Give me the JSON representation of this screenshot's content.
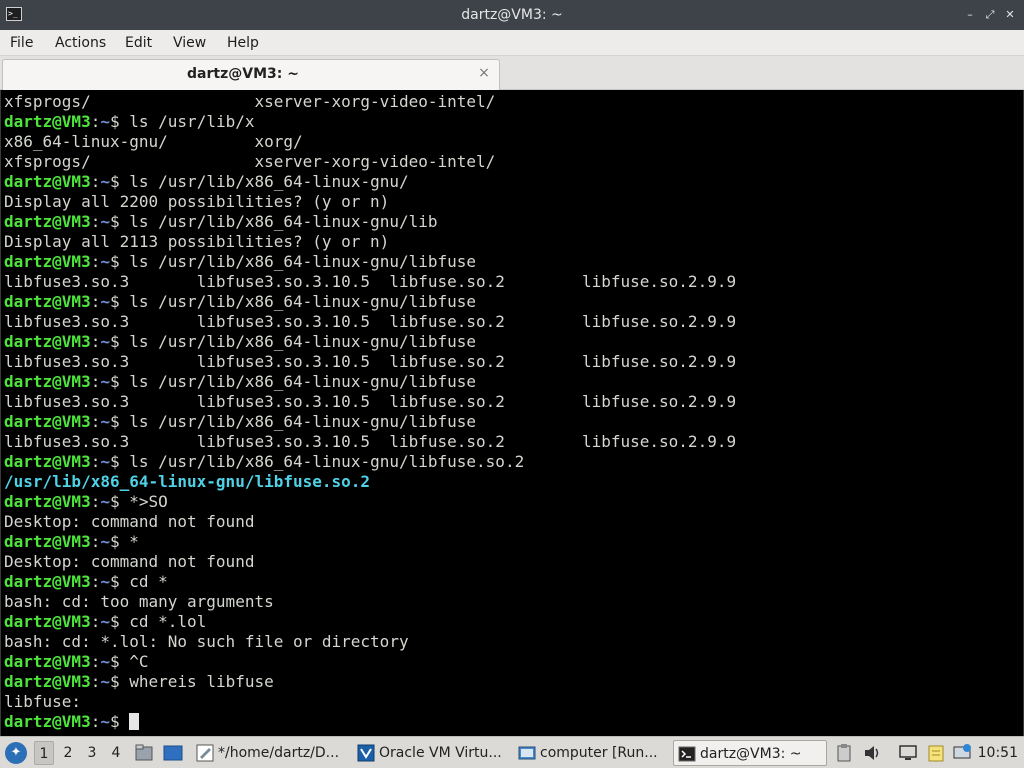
{
  "window": {
    "title": "dartz@VM3: ~",
    "minimize_glyph": "–",
    "maximize_glyph": "⤢",
    "close_glyph": "✕"
  },
  "menu": [
    "File",
    "Actions",
    "Edit",
    "View",
    "Help"
  ],
  "tab": {
    "label": "dartz@VM3: ~",
    "close_glyph": "×"
  },
  "prompt": {
    "user": "dartz@VM3",
    "sep": ":",
    "path": "~",
    "symbol": "$"
  },
  "terminal": {
    "lines": [
      {
        "type": "out",
        "text": "xfsprogs/                 xserver-xorg-video-intel/"
      },
      {
        "type": "cmd",
        "text": " ls /usr/lib/x"
      },
      {
        "type": "out",
        "text": "x86_64-linux-gnu/         xorg/"
      },
      {
        "type": "out",
        "text": "xfsprogs/                 xserver-xorg-video-intel/"
      },
      {
        "type": "cmd",
        "text": " ls /usr/lib/x86_64-linux-gnu/"
      },
      {
        "type": "out",
        "text": "Display all 2200 possibilities? (y or n)"
      },
      {
        "type": "cmd",
        "text": " ls /usr/lib/x86_64-linux-gnu/lib"
      },
      {
        "type": "out",
        "text": "Display all 2113 possibilities? (y or n)"
      },
      {
        "type": "cmd",
        "text": " ls /usr/lib/x86_64-linux-gnu/libfuse"
      },
      {
        "type": "out",
        "text": "libfuse3.so.3       libfuse3.so.3.10.5  libfuse.so.2        libfuse.so.2.9.9"
      },
      {
        "type": "cmd",
        "text": " ls /usr/lib/x86_64-linux-gnu/libfuse"
      },
      {
        "type": "out",
        "text": "libfuse3.so.3       libfuse3.so.3.10.5  libfuse.so.2        libfuse.so.2.9.9"
      },
      {
        "type": "cmd",
        "text": " ls /usr/lib/x86_64-linux-gnu/libfuse"
      },
      {
        "type": "out",
        "text": "libfuse3.so.3       libfuse3.so.3.10.5  libfuse.so.2        libfuse.so.2.9.9"
      },
      {
        "type": "cmd",
        "text": " ls /usr/lib/x86_64-linux-gnu/libfuse"
      },
      {
        "type": "out",
        "text": "libfuse3.so.3       libfuse3.so.3.10.5  libfuse.so.2        libfuse.so.2.9.9"
      },
      {
        "type": "cmd",
        "text": " ls /usr/lib/x86_64-linux-gnu/libfuse"
      },
      {
        "type": "out",
        "text": "libfuse3.so.3       libfuse3.so.3.10.5  libfuse.so.2        libfuse.so.2.9.9"
      },
      {
        "type": "cmd",
        "text": " ls /usr/lib/x86_64-linux-gnu/libfuse.so.2"
      },
      {
        "type": "hl",
        "text": "/usr/lib/x86_64-linux-gnu/libfuse.so.2"
      },
      {
        "type": "cmd",
        "text": " *>SO"
      },
      {
        "type": "out",
        "text": "Desktop: command not found"
      },
      {
        "type": "cmd",
        "text": " *"
      },
      {
        "type": "out",
        "text": "Desktop: command not found"
      },
      {
        "type": "cmd",
        "text": " cd *"
      },
      {
        "type": "out",
        "text": "bash: cd: too many arguments"
      },
      {
        "type": "cmd",
        "text": " cd *.lol"
      },
      {
        "type": "out",
        "text": "bash: cd: *.lol: No such file or directory"
      },
      {
        "type": "cmd",
        "text": " ^C"
      },
      {
        "type": "cmd",
        "text": " whereis libfuse"
      },
      {
        "type": "out",
        "text": "libfuse:"
      },
      {
        "type": "cursor",
        "text": " "
      }
    ]
  },
  "taskbar": {
    "workspaces": [
      "1",
      "2",
      "3",
      "4"
    ],
    "active_workspace": "1",
    "tasks": [
      {
        "label": "*/home/dartz/D...",
        "icon": "text-editor-icon"
      },
      {
        "label": "Oracle VM Virtu...",
        "icon": "virtualbox-icon"
      },
      {
        "label": "computer [Run...",
        "icon": "virtual-machine-icon"
      },
      {
        "label": "dartz@VM3: ~",
        "icon": "terminal-icon"
      }
    ],
    "clock": "10:51"
  },
  "colors": {
    "prompt_user": "#4ee63c",
    "prompt_path": "#6c8fd6",
    "highlight_path": "#4fd1e6",
    "terminal_bg": "#000000",
    "terminal_fg": "#d3d7cf"
  }
}
